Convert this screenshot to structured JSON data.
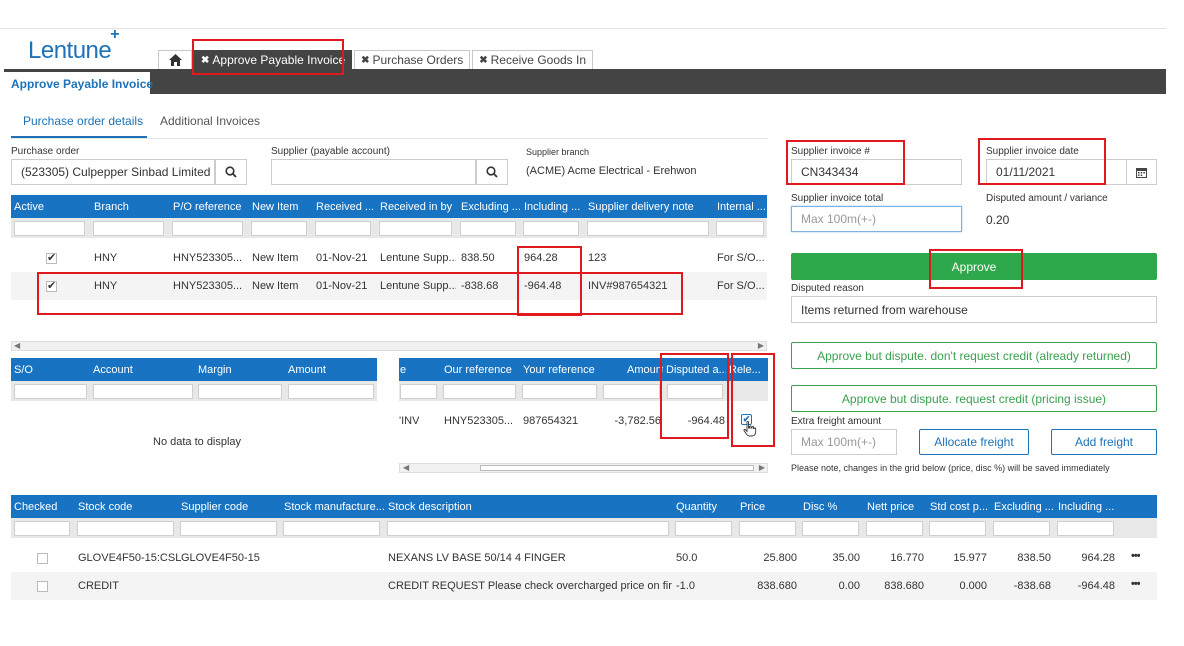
{
  "app": {
    "logo": "Lentune",
    "logo_plus": "+"
  },
  "tabs": [
    {
      "label": ""
    },
    {
      "label": "Approve Payable Invoice"
    },
    {
      "label": "Purchase Orders"
    },
    {
      "label": "Receive Goods In"
    }
  ],
  "page_tab": "Approve Payable Invoice",
  "subtabs": [
    "Purchase order details",
    "Additional Invoices"
  ],
  "form": {
    "purchase_order_label": "Purchase order",
    "purchase_order_value": "(523305) Culpepper Sinbad Limited",
    "supplier_label": "Supplier (payable account)",
    "supplier_value": "",
    "supplier_branch_label": "Supplier branch",
    "supplier_branch_value": "(ACME) Acme Electrical - Erehwon"
  },
  "right": {
    "invoice_no_label": "Supplier invoice #",
    "invoice_no_value": "CN343434",
    "invoice_date_label": "Supplier invoice date",
    "invoice_date_value": "01/11/2021",
    "invoice_total_label": "Supplier invoice total",
    "invoice_total_placeholder": "Max 100m(+-)",
    "disputed_label": "Disputed amount / variance",
    "disputed_value": "0.20",
    "approve_label": "Approve",
    "disputed_reason_label": "Disputed reason",
    "disputed_reason_value": "Items returned from warehouse",
    "dispute_no_credit_label": "Approve but dispute. don't request credit (already returned)",
    "dispute_credit_label": "Approve but dispute. request credit (pricing issue)",
    "extra_freight_label": "Extra freight amount",
    "extra_freight_placeholder": "Max 100m(+-)",
    "allocate_freight_label": "Allocate freight",
    "add_freight_label": "Add freight",
    "note": "Please note, changes in the grid below (price, disc %) will be saved immediately"
  },
  "grid1": {
    "headers": [
      "Active",
      "Branch",
      "P/O reference",
      "New Item",
      "Received ...",
      "Received in by",
      "Excluding ...",
      "Including ...",
      "Supplier delivery note",
      "Internal ..."
    ],
    "rows": [
      {
        "active": "✔",
        "branch": "HNY",
        "po": "HNY523305...",
        "new_item": "New Item",
        "received": "01-Nov-21",
        "received_by": "Lentune Supp...",
        "excl": "838.50",
        "incl": "964.28",
        "note": "123",
        "internal": "For S/O..."
      },
      {
        "active": "✔",
        "branch": "HNY",
        "po": "HNY523305...",
        "new_item": "New Item",
        "received": "01-Nov-21",
        "received_by": "Lentune Supp...",
        "excl": "-838.68",
        "incl": "-964.48",
        "note": "INV#987654321",
        "internal": "For S/O..."
      }
    ]
  },
  "grid2": {
    "headers": [
      "S/O",
      "Account",
      "Margin",
      "Amount"
    ],
    "empty": "No data to display"
  },
  "grid3": {
    "headers": [
      "e",
      "Our reference",
      "Your reference",
      "Amount",
      "Disputed a...",
      "Rele..."
    ],
    "row": {
      "type": "'INV",
      "our_ref": "HNY523305...",
      "your_ref": "987654321",
      "amount": "-3,782.56",
      "disputed": "-964.48",
      "release": "✔"
    }
  },
  "grid4": {
    "headers": [
      "Checked",
      "Stock code",
      "Supplier code",
      "Stock manufacture...",
      "Stock description",
      "Quantity",
      "Price",
      "Disc %",
      "Nett price",
      "Std cost p...",
      "Excluding ...",
      "Including ..."
    ],
    "rows": [
      {
        "stock": "GLOVE4F50-15:CSL",
        "supplier": "GLOVE4F50-15",
        "manu": "",
        "desc": "NEXANS LV BASE 50/14 4 FINGER",
        "qty": "50.0",
        "price": "25.800",
        "disc": "35.00",
        "nett": "16.770",
        "std": "15.977",
        "excl": "838.50",
        "incl": "964.28",
        "more": "•••"
      },
      {
        "stock": "CREDIT",
        "supplier": "",
        "manu": "",
        "desc": "CREDIT REQUEST Please check overcharged price on firs...",
        "qty": "-1.0",
        "price": "838.680",
        "disc": "0.00",
        "nett": "838.680",
        "std": "0.000",
        "excl": "-838.68",
        "incl": "-964.48",
        "more": "•••"
      }
    ]
  },
  "colors": {
    "brand": "#1d72b8",
    "header": "#1874c2",
    "approve": "#2ea84a",
    "highlight": "#e0191f",
    "dark": "#444444"
  }
}
